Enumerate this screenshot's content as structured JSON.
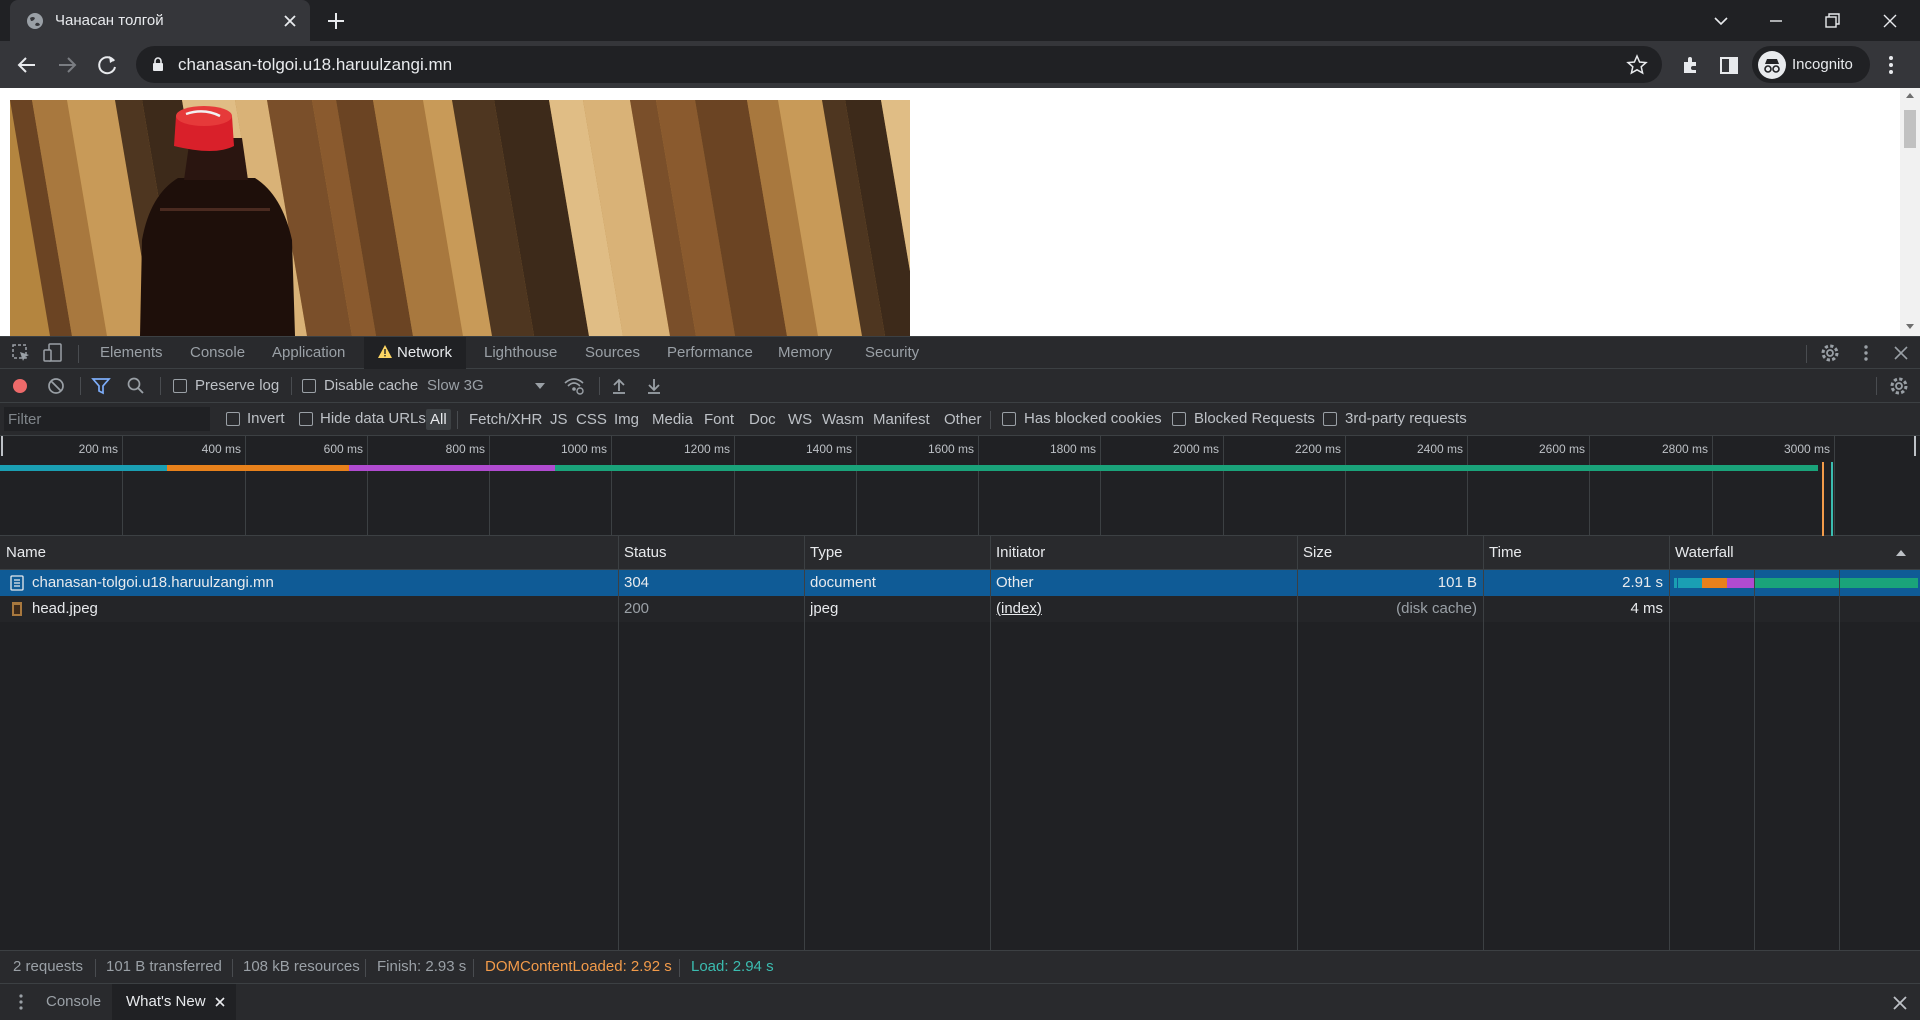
{
  "browser": {
    "tab_title": "Чанасан толгой",
    "url": "chanasan-tolgoi.u18.haruulzangi.mn",
    "profile_label": "Incognito"
  },
  "devtools": {
    "tabs": [
      "Elements",
      "Console",
      "Application",
      "Network",
      "Lighthouse",
      "Sources",
      "Performance",
      "Memory",
      "Security"
    ],
    "active_tab": "Network",
    "toolbar": {
      "preserve_log": "Preserve log",
      "disable_cache": "Disable cache",
      "throttling": "Slow 3G"
    },
    "filterbar": {
      "filter_placeholder": "Filter",
      "invert": "Invert",
      "hide_data_urls": "Hide data URLs",
      "types": [
        "All",
        "Fetch/XHR",
        "JS",
        "CSS",
        "Img",
        "Media",
        "Font",
        "Doc",
        "WS",
        "Wasm",
        "Manifest",
        "Other"
      ],
      "active_type": "All",
      "has_blocked_cookies": "Has blocked cookies",
      "blocked_requests": "Blocked Requests",
      "third_party": "3rd-party requests"
    },
    "overview": {
      "ticks": [
        "200 ms",
        "400 ms",
        "600 ms",
        "800 ms",
        "1000 ms",
        "1200 ms",
        "1400 ms",
        "1600 ms",
        "1800 ms",
        "2000 ms",
        "2200 ms",
        "2400 ms",
        "2600 ms",
        "2800 ms",
        "3000 ms"
      ]
    },
    "table": {
      "columns": [
        "Name",
        "Status",
        "Type",
        "Initiator",
        "Size",
        "Time",
        "Waterfall"
      ],
      "rows": [
        {
          "name": "chanasan-tolgoi.u18.haruulzangi.mn",
          "status": "304",
          "type": "document",
          "initiator": "Other",
          "size": "101 B",
          "time": "2.91 s"
        },
        {
          "name": "head.jpeg",
          "status": "200",
          "type": "jpeg",
          "initiator": "(index)",
          "size": "(disk cache)",
          "time": "4 ms"
        }
      ]
    },
    "summary": {
      "requests": "2 requests",
      "transferred": "101 B transferred",
      "resources": "108 kB resources",
      "finish": "Finish: 2.93 s",
      "dom_content_loaded": "DOMContentLoaded: 2.92 s",
      "load": "Load: 2.94 s"
    },
    "drawer": {
      "tabs": [
        "Console",
        "What's New"
      ],
      "active_tab": "What's New"
    }
  },
  "colors": {
    "dcl": "#f29b4a",
    "load": "#3bbcb0",
    "selected_row": "#0f5b96",
    "wf_waiting": "#1aa37a",
    "wf_connect": "#e8811b",
    "wf_ssl": "#b04bd0",
    "wf_queue": "#1a9fb3"
  }
}
